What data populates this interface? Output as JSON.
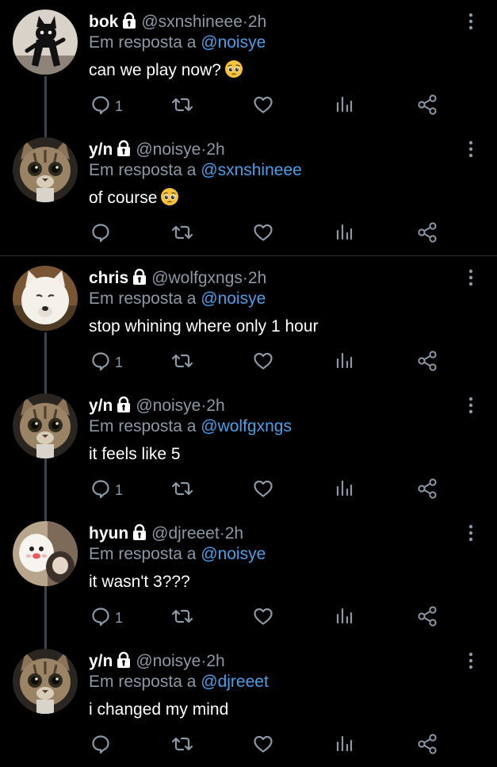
{
  "colors": {
    "background": "#000000",
    "text": "#ffffff",
    "muted": "#8b98a5",
    "link": "#4a9fe8"
  },
  "reply_prefix": "Em resposta a",
  "tweets": [
    {
      "name": "bok",
      "handle": "@sxnshineee",
      "dot": "·",
      "time": "2h",
      "reply_to": "@noisye",
      "text": "can we play now?",
      "emoji": "pleading-face",
      "reply_count": "1",
      "avatar": "black-cat"
    },
    {
      "name": "y/n",
      "handle": "@noisye",
      "dot": "·",
      "time": "2h",
      "reply_to": "@sxnshineee",
      "text": "of course",
      "emoji": "pleading-face",
      "reply_count": "",
      "avatar": "tabby-cat"
    },
    {
      "name": "chris",
      "handle": "@wolfgxngs",
      "dot": "·",
      "time": "2h",
      "reply_to": "@noisye",
      "text": "stop whining where only 1 hour",
      "emoji": "",
      "reply_count": "1",
      "avatar": "white-wolf"
    },
    {
      "name": "y/n",
      "handle": "@noisye",
      "dot": "·",
      "time": "2h",
      "reply_to": "@wolfgxngs",
      "text": "it feels like 5",
      "emoji": "",
      "reply_count": "1",
      "avatar": "tabby-cat"
    },
    {
      "name": "hyun",
      "handle": "@djreeet",
      "dot": "·",
      "time": "2h",
      "reply_to": "@noisye",
      "text": "it wasn't 3???",
      "emoji": "",
      "reply_count": "1",
      "avatar": "plush-toy"
    },
    {
      "name": "y/n",
      "handle": "@noisye",
      "dot": "·",
      "time": "2h",
      "reply_to": "@djreeet",
      "text": "i changed my mind",
      "emoji": "",
      "reply_count": "",
      "avatar": "tabby-cat"
    }
  ]
}
